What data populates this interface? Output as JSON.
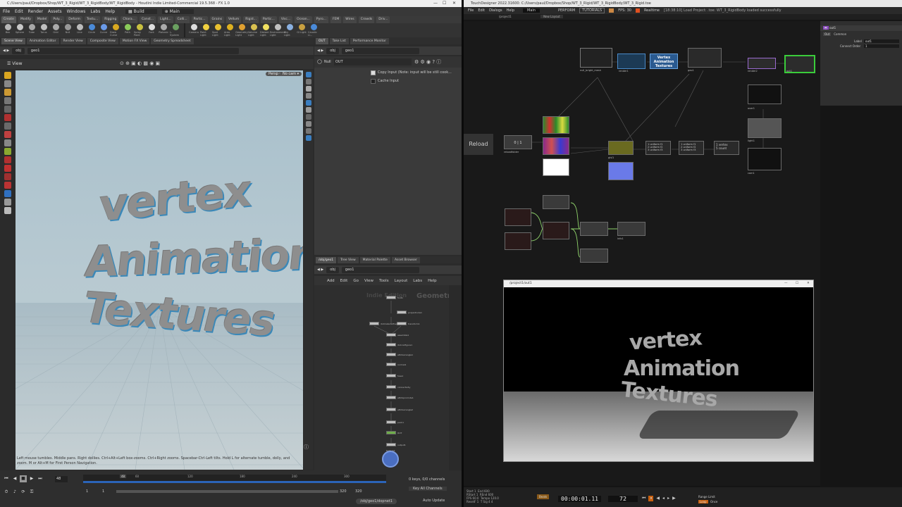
{
  "houdini": {
    "title": "C:/Users/paul/Dropbox/Shop/WT_3_Rigid/WT_3_RigidBody/WT_RigidBody - Houdini Indie Limited-Commercial 19.5.368 - FX 1.0",
    "menu": [
      "File",
      "Edit",
      "Render",
      "Assets",
      "Windows",
      "Labs",
      "Help"
    ],
    "desktop": "Build",
    "workspace": "Main",
    "shelf_tabs": [
      "Create",
      "Modify",
      "Model",
      "Poly...",
      "Deform",
      "Textu...",
      "Rigging",
      "Chara...",
      "Const...",
      "Light...",
      "Colli...",
      "Partic...",
      "Grains",
      "Vellum",
      "Rigid...",
      "Partic...",
      "Visc...",
      "Ocean...",
      "Pyro...",
      "FEM",
      "Wires",
      "Crowds",
      "Driv..."
    ],
    "shelf_tools": [
      "Box",
      "Sphere",
      "Tube",
      "Torus",
      "Grid",
      "Null",
      "Line",
      "Circle",
      "Curve",
      "Draw Curve",
      "Path",
      "Spray Paint",
      "Font",
      "Platonic",
      "L-System"
    ],
    "light_tools": [
      "Camera",
      "Point Light",
      "Spot Light",
      "Area Light",
      "Geometry Light",
      "Volume Light",
      "Distant Light",
      "Environment Light",
      "Sky Light",
      "GI Light",
      "Caustic Li..."
    ],
    "pane_tabs_left": [
      "Scene View",
      "Animation Editor",
      "Render View",
      "Composite View",
      "Motion FX View",
      "Geometry Spreadsheet"
    ],
    "pane_tabs_param": [
      "OUT",
      "Take List",
      "Performance Monitor"
    ],
    "path_obj": "obj",
    "path_geo": "geo1",
    "view_label": "View",
    "persp_label": "Persp",
    "nocam_label": "No cam",
    "viewport_words": [
      "vertex",
      "Animation",
      "Textures"
    ],
    "viewport_help": "Left mouse tumbles. Middle pans. Right dollies. Ctrl+Alt+Left box-zooms. Ctrl+Right zooms. Spacebar-Ctrl-Left tilts. Hold L for alternate tumble, dolly, and zoom.    M or Alt+M for First Person Navigation.",
    "param_node_type": "Null",
    "param_node_name": "OUT",
    "param_copy_input": "Copy Input (Note: input will be still cook...",
    "param_cache_input": "Cache Input",
    "network_tabs": [
      "/obj/geo1",
      "Tree View",
      "Material Palette",
      "Asset Browser"
    ],
    "network_menu": [
      "Add",
      "Edit",
      "Go",
      "View",
      "Tools",
      "Layout",
      "Labs",
      "Help"
    ],
    "network_watermark_left": "Indie Edition",
    "network_watermark_right": "Geometry",
    "network_nodes": [
      "font1",
      "polyextrude1",
      "rbdmaterialfracture1",
      "transform1",
      "assemble1",
      "rbdconfigure1",
      "attribwrangle1",
      "normal1",
      "fuse1",
      "connectivity",
      "attribpromote1",
      "attribwrangle2",
      "pack1",
      "OUT",
      "output1",
      "texture1"
    ],
    "timeline": {
      "current_frame": "48",
      "start_frame": "1",
      "range_start": "1",
      "range_end": "320",
      "end_frame": "320",
      "ticks": [
        "48",
        "60",
        "120",
        "180",
        "240",
        "300"
      ],
      "keys_label": "0 keys, 0/0 channels",
      "key_all_label": "Key All Channels",
      "path": "/obj/geo1/dopnet1",
      "auto_update": "Auto Update"
    }
  },
  "touchdesigner": {
    "title": "TouchDesigner 2022.31600: C:/Users/paul/Dropbox/Shop/WT_3_Rigid/WT_3_RigidBody/WT_3_Rigid.toe",
    "menu": [
      "File",
      "Edit",
      "Dialogs",
      "Help"
    ],
    "top_fields": [
      "Main",
      "PERFORM",
      "TUTORIALS",
      "FPS: 30",
      "Realtime"
    ],
    "status_msg": "[18:38:10] Load Project: .toe: WT_3_RigidBody loaded successfully",
    "path": "/project1",
    "layout_label": "New Layout",
    "reload_label": "Reload",
    "nodes": {
      "null_bright_mesh": "null_bright_mesh",
      "vertex_anim": "Vertex\nAnimation\nTextures",
      "render1": "render1",
      "geo1": "geo1",
      "render2": "render2",
      "out1": "out1",
      "over1": "over1",
      "light1": "light1",
      "cam1": "cam1",
      "reloadfolder": "reloadfolder",
      "cnt1": "0 | 1",
      "glsl1": "glsl1",
      "uniforms": "1 uniform f1\n2 uniform f2\n3 uniform f3",
      "vertex_count": "1 vertex\n5 count",
      "info1": "info1"
    },
    "viewer": {
      "title": "/project1/out1",
      "words": [
        "vertex",
        "Animation",
        "Textures"
      ]
    },
    "params": {
      "op": "out1",
      "tabs": [
        "Out",
        "Common"
      ],
      "label_key": "Label",
      "label_val": "out1",
      "order_key": "Connect Order",
      "order_val": "1"
    },
    "bottom": {
      "start": "1",
      "end": "600",
      "rstart": "1",
      "rend": "600",
      "fps": "60.0",
      "tempo": "120.0",
      "resetf": "1",
      "tsig": "4 4",
      "timecode": "00:00:01.11",
      "frame": "72",
      "range_limit": "Range Limit",
      "loop": "Loop",
      "once": "Once",
      "beats": "Beats"
    }
  },
  "colors": {
    "houdini_bg": "#2b2b2b",
    "viewport_sky": "#a9c0cc",
    "accent_blue": "#2c8fd6",
    "td_bg": "#151515"
  }
}
